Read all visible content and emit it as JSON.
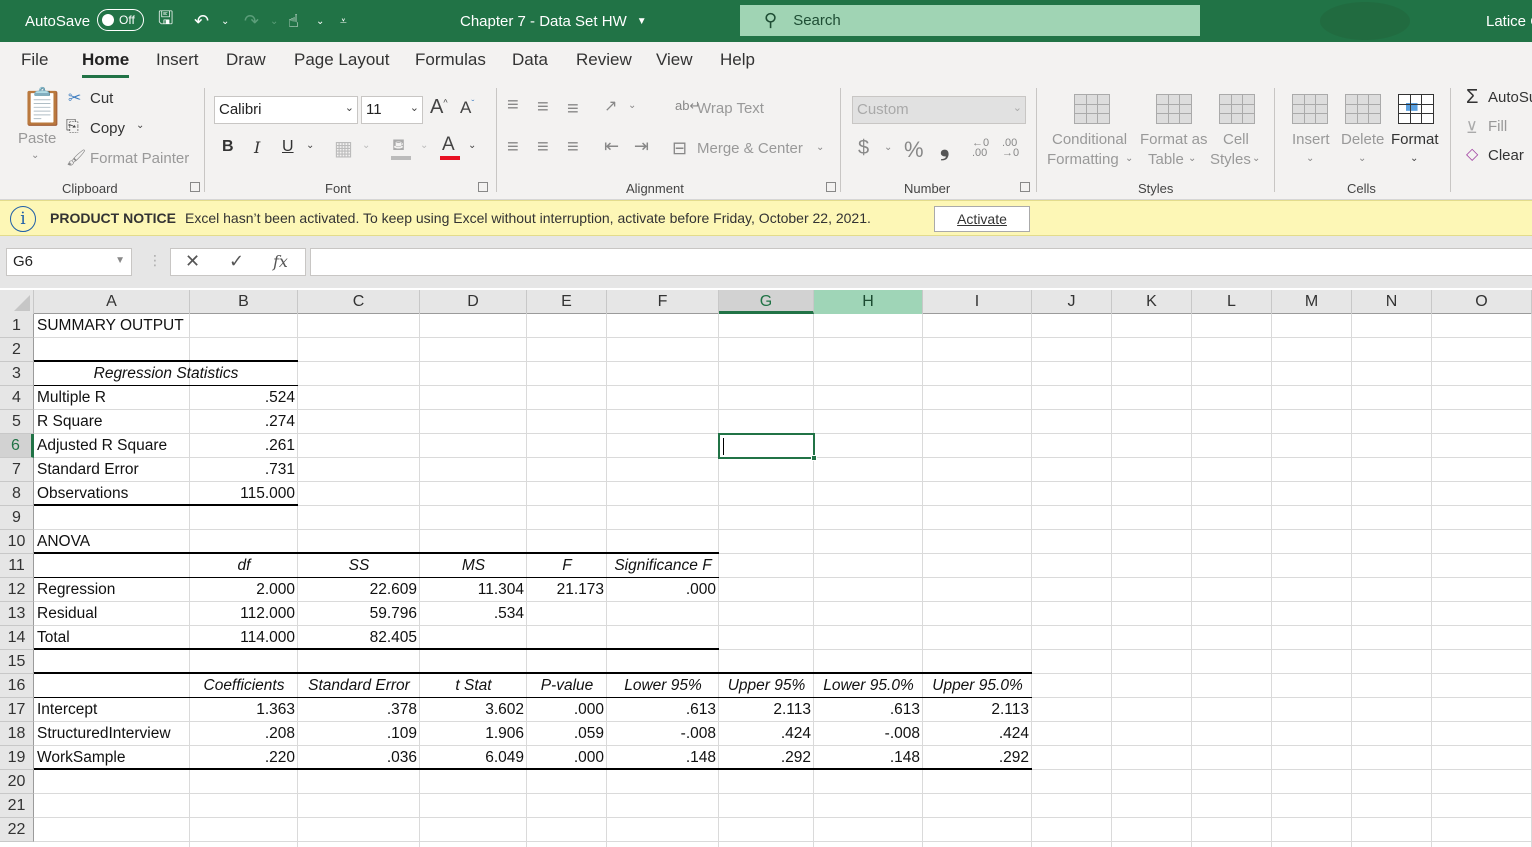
{
  "titlebar": {
    "autosave_label": "AutoSave",
    "autosave_state": "Off",
    "doc_title": "Chapter 7 - Data Set HW",
    "search_placeholder": "Search",
    "user_name": "Latice C",
    "accent_color": "#217346"
  },
  "tabs": [
    {
      "label": "File"
    },
    {
      "label": "Home",
      "active": true
    },
    {
      "label": "Insert"
    },
    {
      "label": "Draw"
    },
    {
      "label": "Page Layout"
    },
    {
      "label": "Formulas"
    },
    {
      "label": "Data"
    },
    {
      "label": "Review"
    },
    {
      "label": "View"
    },
    {
      "label": "Help"
    }
  ],
  "ribbon": {
    "clipboard": {
      "label": "Clipboard",
      "paste": "Paste",
      "cut": "Cut",
      "copy": "Copy",
      "format_painter": "Format Painter"
    },
    "font": {
      "label": "Font",
      "font_name": "Calibri",
      "font_size": "11",
      "bold": "B",
      "italic": "I",
      "underline": "U",
      "font_color": "#e81123"
    },
    "alignment": {
      "label": "Alignment",
      "wrap_text": "Wrap Text",
      "merge_center": "Merge & Center"
    },
    "number": {
      "label": "Number",
      "format": "Custom",
      "currency": "$",
      "percent": "%",
      "comma": "❟"
    },
    "styles": {
      "label": "Styles",
      "conditional_formatting_1": "Conditional",
      "conditional_formatting_2": "Formatting",
      "format_as_table_1": "Format as",
      "format_as_table_2": "Table",
      "cell_styles_1": "Cell",
      "cell_styles_2": "Styles"
    },
    "cells": {
      "label": "Cells",
      "insert": "Insert",
      "delete": "Delete",
      "format": "Format"
    },
    "editing": {
      "autosum": "AutoSum",
      "fill": "Fill",
      "clear": "Clear"
    }
  },
  "notice": {
    "title": "PRODUCT NOTICE",
    "message": "Excel hasn’t been activated. To keep using Excel without interruption, activate before Friday, October 22, 2021.",
    "button": "Activate"
  },
  "formula_bar": {
    "name_box": "G6",
    "cancel": "✕",
    "enter": "✓",
    "fx": "fx",
    "formula": ""
  },
  "grid": {
    "columns": [
      "A",
      "B",
      "C",
      "D",
      "E",
      "F",
      "G",
      "H",
      "I",
      "J",
      "K",
      "L",
      "M",
      "N",
      "O"
    ],
    "rows": [
      "1",
      "2",
      "3",
      "4",
      "5",
      "6",
      "7",
      "8",
      "9",
      "10",
      "11",
      "12",
      "13",
      "14",
      "15",
      "16",
      "17",
      "18",
      "19",
      "20",
      "21",
      "22"
    ],
    "selected_cell": "G6"
  },
  "sheet": {
    "summary_title": "SUMMARY OUTPUT",
    "regression_statistics": {
      "header": "Regression Statistics",
      "rows": [
        {
          "label": "Multiple R",
          "value": ".524"
        },
        {
          "label": "R Square",
          "value": ".274"
        },
        {
          "label": "Adjusted R Square",
          "value": ".261"
        },
        {
          "label": "Standard Error",
          "value": ".731"
        },
        {
          "label": "Observations",
          "value": "115.000"
        }
      ]
    },
    "anova": {
      "title": "ANOVA",
      "headers": [
        "",
        "df",
        "SS",
        "MS",
        "F",
        "Significance F"
      ],
      "rows": [
        [
          "Regression",
          "2.000",
          "22.609",
          "11.304",
          "21.173",
          ".000"
        ],
        [
          "Residual",
          "112.000",
          "59.796",
          ".534",
          "",
          ""
        ],
        [
          "Total",
          "114.000",
          "82.405",
          "",
          "",
          ""
        ]
      ]
    },
    "coefficients": {
      "headers": [
        "",
        "Coefficients",
        "Standard Error",
        "t Stat",
        "P-value",
        "Lower 95%",
        "Upper 95%",
        "Lower 95.0%",
        "Upper 95.0%"
      ],
      "rows": [
        [
          "Intercept",
          "1.363",
          ".378",
          "3.602",
          ".000",
          ".613",
          "2.113",
          ".613",
          "2.113"
        ],
        [
          "StructuredInterview",
          ".208",
          ".109",
          "1.906",
          ".059",
          "-.008",
          ".424",
          "-.008",
          ".424"
        ],
        [
          "WorkSample",
          ".220",
          ".036",
          "6.049",
          ".000",
          ".148",
          ".292",
          ".148",
          ".292"
        ]
      ]
    }
  }
}
